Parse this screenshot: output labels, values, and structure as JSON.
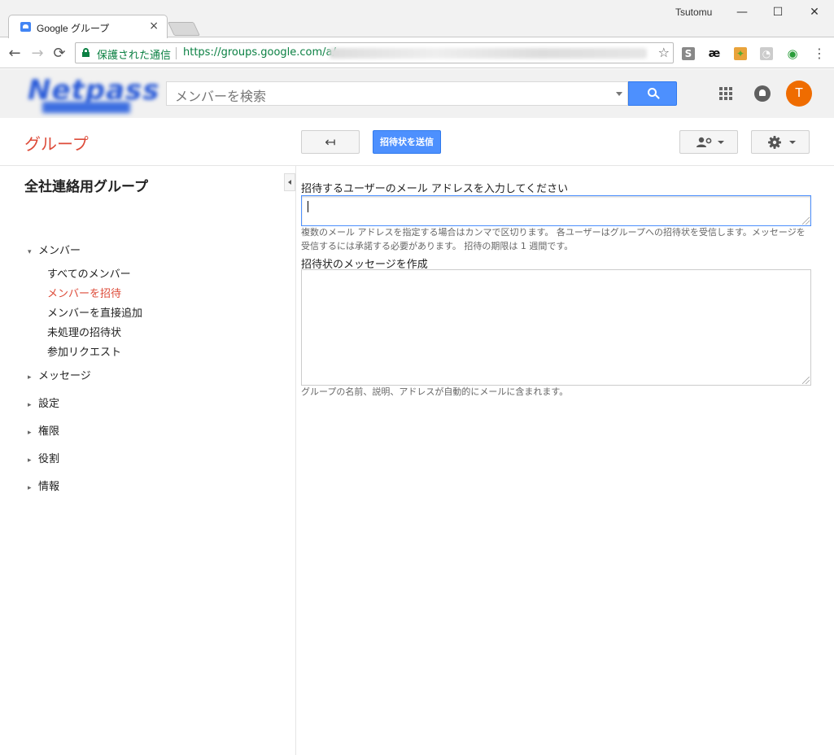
{
  "browser": {
    "tab_title": "Google グループ",
    "tab_close": "×",
    "user_name": "Tsutomu",
    "window_controls": {
      "minimize": "—",
      "maximize": "☐",
      "close": "✕"
    },
    "nav": {
      "back": "←",
      "forward": "→",
      "reload": "⟳"
    },
    "secure_label": "保護された通信",
    "url": "https://groups.google.com/a/",
    "star": "☆",
    "menu": "⋮",
    "extensions": [
      "ext-s-icon",
      "ae-icon",
      "puzzle-icon",
      "rss-icon",
      "circle-icon"
    ],
    "extension_glyphs": [
      "S",
      "æ",
      "✦",
      "◔",
      "◉"
    ]
  },
  "header": {
    "search_placeholder": "メンバーを検索",
    "avatar_letter": "T",
    "accent": "#4d90fe",
    "avatar_color": "#ef6c00"
  },
  "actionbar": {
    "app_title": "グループ",
    "back_icon": "↤",
    "send_label": "招待状を送信"
  },
  "sidebar": {
    "group_name": "全社連絡用グループ",
    "members_heading": "メンバー",
    "member_items": [
      {
        "label": "すべてのメンバー",
        "active": false
      },
      {
        "label": "メンバーを招待",
        "active": true
      },
      {
        "label": "メンバーを直接追加",
        "active": false
      },
      {
        "label": "未処理の招待状",
        "active": false
      },
      {
        "label": "参加リクエスト",
        "active": false
      }
    ],
    "sections": [
      "メッセージ",
      "設定",
      "権限",
      "役割",
      "情報"
    ],
    "expanded_glyph": "▾",
    "collapsed_glyph": "▸"
  },
  "form": {
    "email_label": "招待するユーザーのメール アドレスを入力してください",
    "email_value": "",
    "email_hint": "複数のメール アドレスを指定する場合はカンマで区切ります。 各ユーザーはグループへの招待状を受信します。メッセージを受信するには承諾する必要があります。 招待の期限は 1 週間です。",
    "message_label": "招待状のメッセージを作成",
    "message_value": "",
    "message_hint": "グループの名前、説明、アドレスが自動的にメールに含まれます。"
  }
}
